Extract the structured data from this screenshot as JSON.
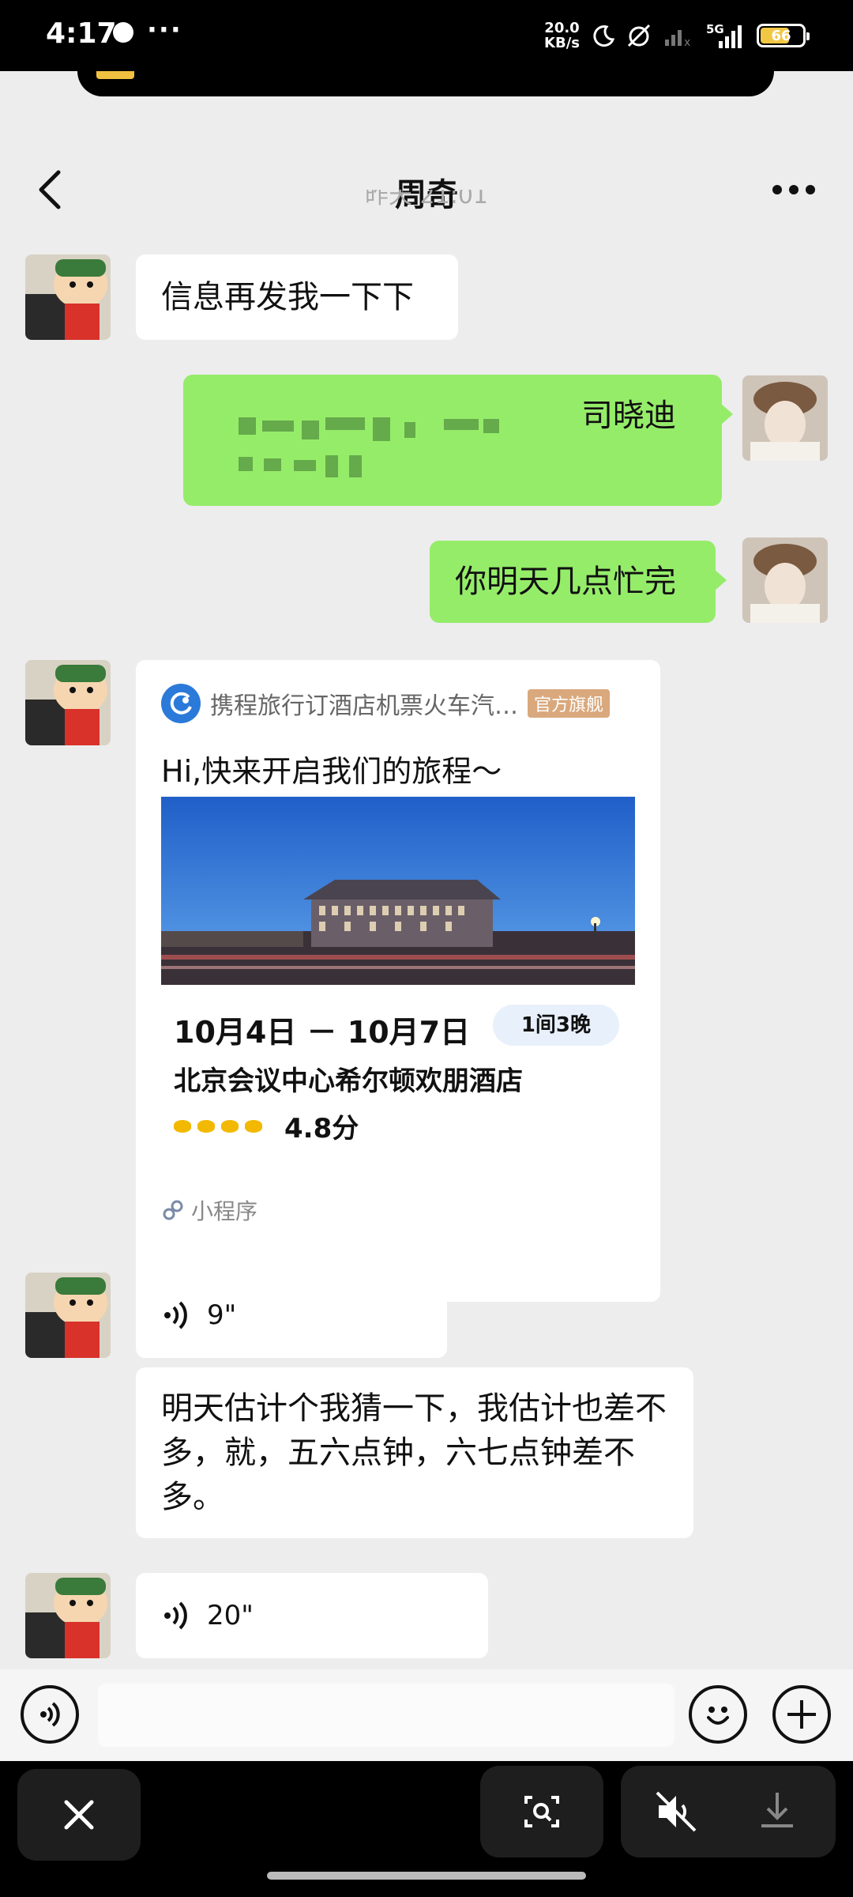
{
  "status_bar": {
    "time": "4:17",
    "more": "···",
    "net_speed_value": "20.0",
    "net_speed_unit": "KB/s",
    "signal_label": "5G",
    "battery": "66"
  },
  "header": {
    "title": "周奇",
    "timestamp": "昨天 21:01"
  },
  "messages": [
    {
      "side": "in",
      "text": "信息再发我一下下"
    },
    {
      "side": "out",
      "text": "司晓迪"
    },
    {
      "side": "out",
      "text": "你明天几点忙完"
    },
    {
      "side": "in",
      "type": "mini_program"
    },
    {
      "side": "in",
      "type": "voice",
      "duration": "9\""
    },
    {
      "side": "in",
      "text": "明天估计个我猜一下，我估计也差不多，就，五六点钟，六七点钟差不多。"
    },
    {
      "side": "in",
      "type": "voice",
      "duration": "20\""
    }
  ],
  "mini_program_card": {
    "source": "携程旅行订酒店机票火车汽…",
    "badge": "官方旗舰",
    "greeting": "Hi,快来开启我们的旅程～",
    "dates": "10月4日 － 10月7日",
    "nights": "1间3晚",
    "hotel": "北京会议中心希尔顿欢朋酒店",
    "score": "4.8分",
    "diamonds": 4,
    "footer": "小程序"
  },
  "colors": {
    "chat_bg": "#ededed",
    "out_bubble": "#95ec69",
    "in_bubble": "#ffffff",
    "badge": "#d9a87c",
    "rating": "#f2b900"
  },
  "icons": [
    "back-icon",
    "more-icon",
    "voice-input-icon",
    "emoji-icon",
    "plus-icon",
    "close-icon",
    "scan-icon",
    "mute-icon",
    "download-icon"
  ]
}
